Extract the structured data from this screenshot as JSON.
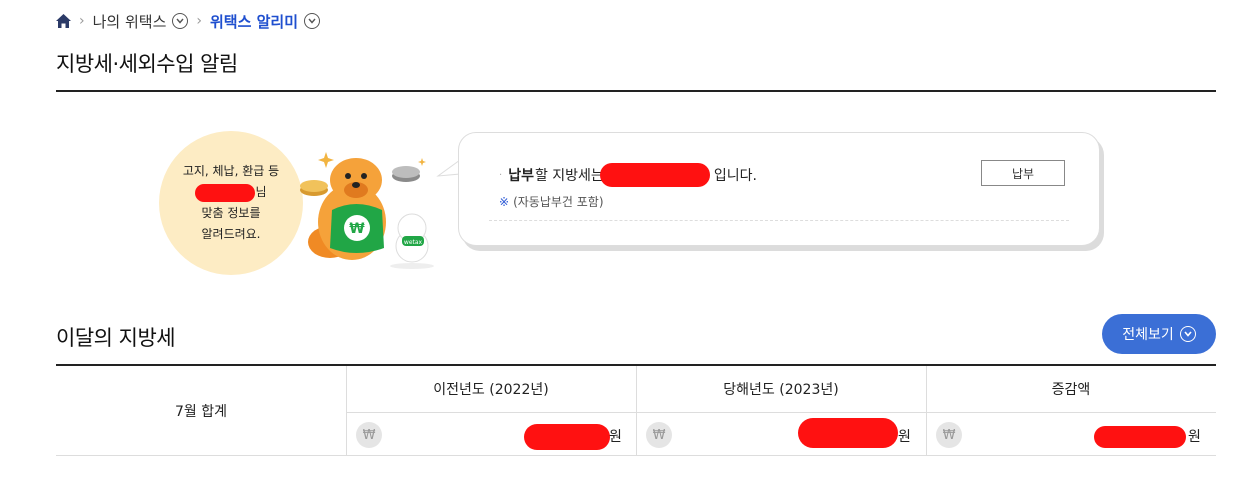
{
  "breadcrumb": {
    "item1": "나의 위택스",
    "current": "위택스 알리미"
  },
  "page_title": "지방세·세외수입 알림",
  "notice": {
    "line1": "고지, 체납, 환급 등",
    "name_suffix": "님",
    "line3": "맞춤 정보를",
    "line4": "알려드려요."
  },
  "bubble": {
    "bold_text": "납부",
    "text_mid": "할 지방세는",
    "text_end": "입니다.",
    "note_mark": "※",
    "note": "(자동납부건 포함)",
    "pay_button": "납부"
  },
  "section": {
    "title": "이달의 지방세",
    "view_all": "전체보기"
  },
  "table": {
    "row_label": "7월 합계",
    "headers": [
      "이전년도 (2022년)",
      "당해년도 (2023년)",
      "증감액"
    ],
    "currency_symbol": "₩",
    "unit": "원"
  }
}
